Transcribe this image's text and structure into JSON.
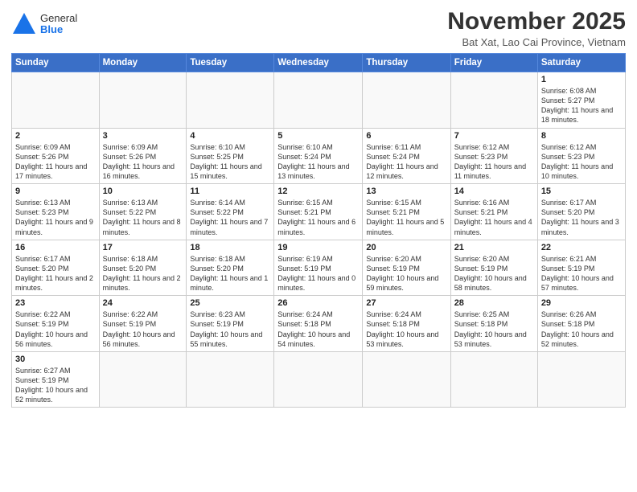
{
  "header": {
    "logo_general": "General",
    "logo_blue": "Blue",
    "month_title": "November 2025",
    "subtitle": "Bat Xat, Lao Cai Province, Vietnam"
  },
  "weekdays": [
    "Sunday",
    "Monday",
    "Tuesday",
    "Wednesday",
    "Thursday",
    "Friday",
    "Saturday"
  ],
  "weeks": [
    [
      {
        "day": "",
        "info": ""
      },
      {
        "day": "",
        "info": ""
      },
      {
        "day": "",
        "info": ""
      },
      {
        "day": "",
        "info": ""
      },
      {
        "day": "",
        "info": ""
      },
      {
        "day": "",
        "info": ""
      },
      {
        "day": "1",
        "info": "Sunrise: 6:08 AM\nSunset: 5:27 PM\nDaylight: 11 hours and 18 minutes."
      }
    ],
    [
      {
        "day": "2",
        "info": "Sunrise: 6:09 AM\nSunset: 5:26 PM\nDaylight: 11 hours and 17 minutes."
      },
      {
        "day": "3",
        "info": "Sunrise: 6:09 AM\nSunset: 5:26 PM\nDaylight: 11 hours and 16 minutes."
      },
      {
        "day": "4",
        "info": "Sunrise: 6:10 AM\nSunset: 5:25 PM\nDaylight: 11 hours and 15 minutes."
      },
      {
        "day": "5",
        "info": "Sunrise: 6:10 AM\nSunset: 5:24 PM\nDaylight: 11 hours and 13 minutes."
      },
      {
        "day": "6",
        "info": "Sunrise: 6:11 AM\nSunset: 5:24 PM\nDaylight: 11 hours and 12 minutes."
      },
      {
        "day": "7",
        "info": "Sunrise: 6:12 AM\nSunset: 5:23 PM\nDaylight: 11 hours and 11 minutes."
      },
      {
        "day": "8",
        "info": "Sunrise: 6:12 AM\nSunset: 5:23 PM\nDaylight: 11 hours and 10 minutes."
      }
    ],
    [
      {
        "day": "9",
        "info": "Sunrise: 6:13 AM\nSunset: 5:23 PM\nDaylight: 11 hours and 9 minutes."
      },
      {
        "day": "10",
        "info": "Sunrise: 6:13 AM\nSunset: 5:22 PM\nDaylight: 11 hours and 8 minutes."
      },
      {
        "day": "11",
        "info": "Sunrise: 6:14 AM\nSunset: 5:22 PM\nDaylight: 11 hours and 7 minutes."
      },
      {
        "day": "12",
        "info": "Sunrise: 6:15 AM\nSunset: 5:21 PM\nDaylight: 11 hours and 6 minutes."
      },
      {
        "day": "13",
        "info": "Sunrise: 6:15 AM\nSunset: 5:21 PM\nDaylight: 11 hours and 5 minutes."
      },
      {
        "day": "14",
        "info": "Sunrise: 6:16 AM\nSunset: 5:21 PM\nDaylight: 11 hours and 4 minutes."
      },
      {
        "day": "15",
        "info": "Sunrise: 6:17 AM\nSunset: 5:20 PM\nDaylight: 11 hours and 3 minutes."
      }
    ],
    [
      {
        "day": "16",
        "info": "Sunrise: 6:17 AM\nSunset: 5:20 PM\nDaylight: 11 hours and 2 minutes."
      },
      {
        "day": "17",
        "info": "Sunrise: 6:18 AM\nSunset: 5:20 PM\nDaylight: 11 hours and 2 minutes."
      },
      {
        "day": "18",
        "info": "Sunrise: 6:18 AM\nSunset: 5:20 PM\nDaylight: 11 hours and 1 minute."
      },
      {
        "day": "19",
        "info": "Sunrise: 6:19 AM\nSunset: 5:19 PM\nDaylight: 11 hours and 0 minutes."
      },
      {
        "day": "20",
        "info": "Sunrise: 6:20 AM\nSunset: 5:19 PM\nDaylight: 10 hours and 59 minutes."
      },
      {
        "day": "21",
        "info": "Sunrise: 6:20 AM\nSunset: 5:19 PM\nDaylight: 10 hours and 58 minutes."
      },
      {
        "day": "22",
        "info": "Sunrise: 6:21 AM\nSunset: 5:19 PM\nDaylight: 10 hours and 57 minutes."
      }
    ],
    [
      {
        "day": "23",
        "info": "Sunrise: 6:22 AM\nSunset: 5:19 PM\nDaylight: 10 hours and 56 minutes."
      },
      {
        "day": "24",
        "info": "Sunrise: 6:22 AM\nSunset: 5:19 PM\nDaylight: 10 hours and 56 minutes."
      },
      {
        "day": "25",
        "info": "Sunrise: 6:23 AM\nSunset: 5:19 PM\nDaylight: 10 hours and 55 minutes."
      },
      {
        "day": "26",
        "info": "Sunrise: 6:24 AM\nSunset: 5:18 PM\nDaylight: 10 hours and 54 minutes."
      },
      {
        "day": "27",
        "info": "Sunrise: 6:24 AM\nSunset: 5:18 PM\nDaylight: 10 hours and 53 minutes."
      },
      {
        "day": "28",
        "info": "Sunrise: 6:25 AM\nSunset: 5:18 PM\nDaylight: 10 hours and 53 minutes."
      },
      {
        "day": "29",
        "info": "Sunrise: 6:26 AM\nSunset: 5:18 PM\nDaylight: 10 hours and 52 minutes."
      }
    ],
    [
      {
        "day": "30",
        "info": "Sunrise: 6:27 AM\nSunset: 5:19 PM\nDaylight: 10 hours and 52 minutes."
      },
      {
        "day": "",
        "info": ""
      },
      {
        "day": "",
        "info": ""
      },
      {
        "day": "",
        "info": ""
      },
      {
        "day": "",
        "info": ""
      },
      {
        "day": "",
        "info": ""
      },
      {
        "day": "",
        "info": ""
      }
    ]
  ]
}
